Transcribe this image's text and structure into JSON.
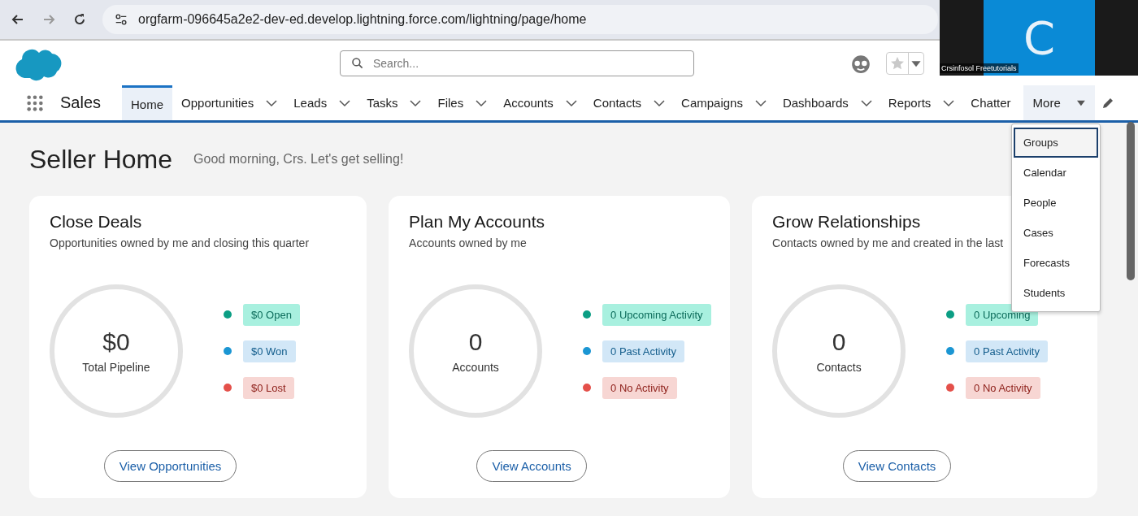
{
  "browser": {
    "url": "orgfarm-096645a2e2-dev-ed.develop.lightning.force.com/lightning/page/home"
  },
  "app": {
    "name": "Sales",
    "search_placeholder": "Search..."
  },
  "nav": [
    {
      "label": "Home",
      "selected": true,
      "menu": false
    },
    {
      "label": "Opportunities",
      "selected": false,
      "menu": true
    },
    {
      "label": "Leads",
      "selected": false,
      "menu": true
    },
    {
      "label": "Tasks",
      "selected": false,
      "menu": true
    },
    {
      "label": "Files",
      "selected": false,
      "menu": true
    },
    {
      "label": "Accounts",
      "selected": false,
      "menu": true
    },
    {
      "label": "Contacts",
      "selected": false,
      "menu": true
    },
    {
      "label": "Campaigns",
      "selected": false,
      "menu": true
    },
    {
      "label": "Dashboards",
      "selected": false,
      "menu": true
    },
    {
      "label": "Reports",
      "selected": false,
      "menu": true
    },
    {
      "label": "Chatter",
      "selected": false,
      "menu": false
    }
  ],
  "more_tab": {
    "label": "More",
    "expanded": true
  },
  "more_menu": [
    {
      "label": "Groups",
      "selected": true
    },
    {
      "label": "Calendar",
      "selected": false
    },
    {
      "label": "People",
      "selected": false
    },
    {
      "label": "Cases",
      "selected": false
    },
    {
      "label": "Forecasts",
      "selected": false
    },
    {
      "label": "Students",
      "selected": false
    }
  ],
  "page": {
    "title": "Seller Home",
    "greeting": "Good morning, Crs. Let's get selling!"
  },
  "cards": [
    {
      "title": "Close Deals",
      "subtitle": "Opportunities owned by me and closing this quarter",
      "value": "$0",
      "value_label": "Total Pipeline",
      "legend": [
        {
          "label": "$0 Open",
          "kind": "upcoming",
          "color": "#0b9e84"
        },
        {
          "label": "$0 Won",
          "kind": "past",
          "color": "#1b96d3"
        },
        {
          "label": "$0 Lost",
          "kind": "none",
          "color": "#e4504a"
        }
      ],
      "button": "View Opportunities"
    },
    {
      "title": "Plan My Accounts",
      "subtitle": "Accounts owned by me",
      "value": "0",
      "value_label": "Accounts",
      "legend": [
        {
          "label": "0 Upcoming Activity",
          "kind": "upcoming",
          "color": "#0b9e84"
        },
        {
          "label": "0 Past Activity",
          "kind": "past",
          "color": "#1b96d3"
        },
        {
          "label": "0 No Activity",
          "kind": "none",
          "color": "#e4504a"
        }
      ],
      "button": "View Accounts"
    },
    {
      "title": "Grow Relationships",
      "subtitle": "Contacts owned by me and created in the last",
      "value": "0",
      "value_label": "Contacts",
      "legend": [
        {
          "label": "0 Upcoming",
          "kind": "upcoming",
          "color": "#0b9e84"
        },
        {
          "label": "0 Past Activity",
          "kind": "past",
          "color": "#1b96d3"
        },
        {
          "label": "0 No Activity",
          "kind": "none",
          "color": "#e4504a"
        }
      ],
      "button": "View Contacts"
    }
  ],
  "webcam": {
    "initial": "C",
    "caption": "Crsinfosol Freetutorials"
  }
}
